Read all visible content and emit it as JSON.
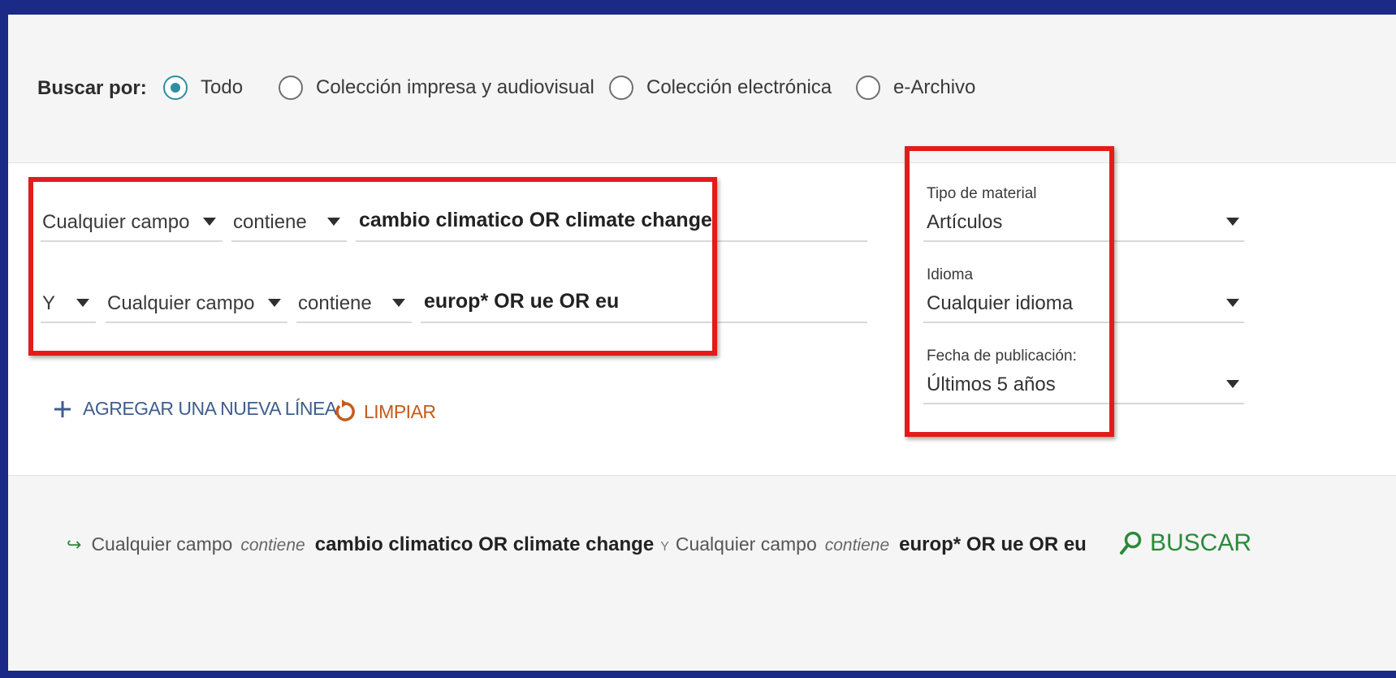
{
  "scope": {
    "label": "Buscar por:",
    "options": [
      {
        "label": "Todo",
        "checked": true
      },
      {
        "label": "Colección impresa y audiovisual",
        "checked": false
      },
      {
        "label": "Colección electrónica",
        "checked": false
      },
      {
        "label": "e-Archivo",
        "checked": false
      }
    ]
  },
  "rows": [
    {
      "field": "Cualquier campo",
      "operator": "contiene",
      "value": "cambio climatico OR climate change"
    },
    {
      "boolean": "Y",
      "field": "Cualquier campo",
      "operator": "contiene",
      "value": "europ* OR ue OR eu"
    }
  ],
  "actions": {
    "add_line": "AGREGAR UNA NUEVA LÍNEA",
    "clear": "LIMPIAR"
  },
  "filters": {
    "material": {
      "label": "Tipo de material",
      "value": "Artículos"
    },
    "language": {
      "label": "Idioma",
      "value": "Cualquier idioma"
    },
    "date": {
      "label": "Fecha de publicación:",
      "value": "Últimos 5 años"
    }
  },
  "summary": {
    "clause1": {
      "field": "Cualquier campo",
      "operator": "contiene",
      "term": "cambio climatico OR climate change"
    },
    "boolean": "Y",
    "clause2": {
      "field": "Cualquier campo",
      "operator": "contiene",
      "term": "europ* OR ue OR eu"
    }
  },
  "search_button": "BUSCAR",
  "colors": {
    "frame": "#1a2a86",
    "highlight": "#e31b1b",
    "radio_accent": "#2c8fa0",
    "search_green": "#2a8a3a",
    "clear_orange": "#c65a1e",
    "add_blue": "#3f5d8f"
  }
}
